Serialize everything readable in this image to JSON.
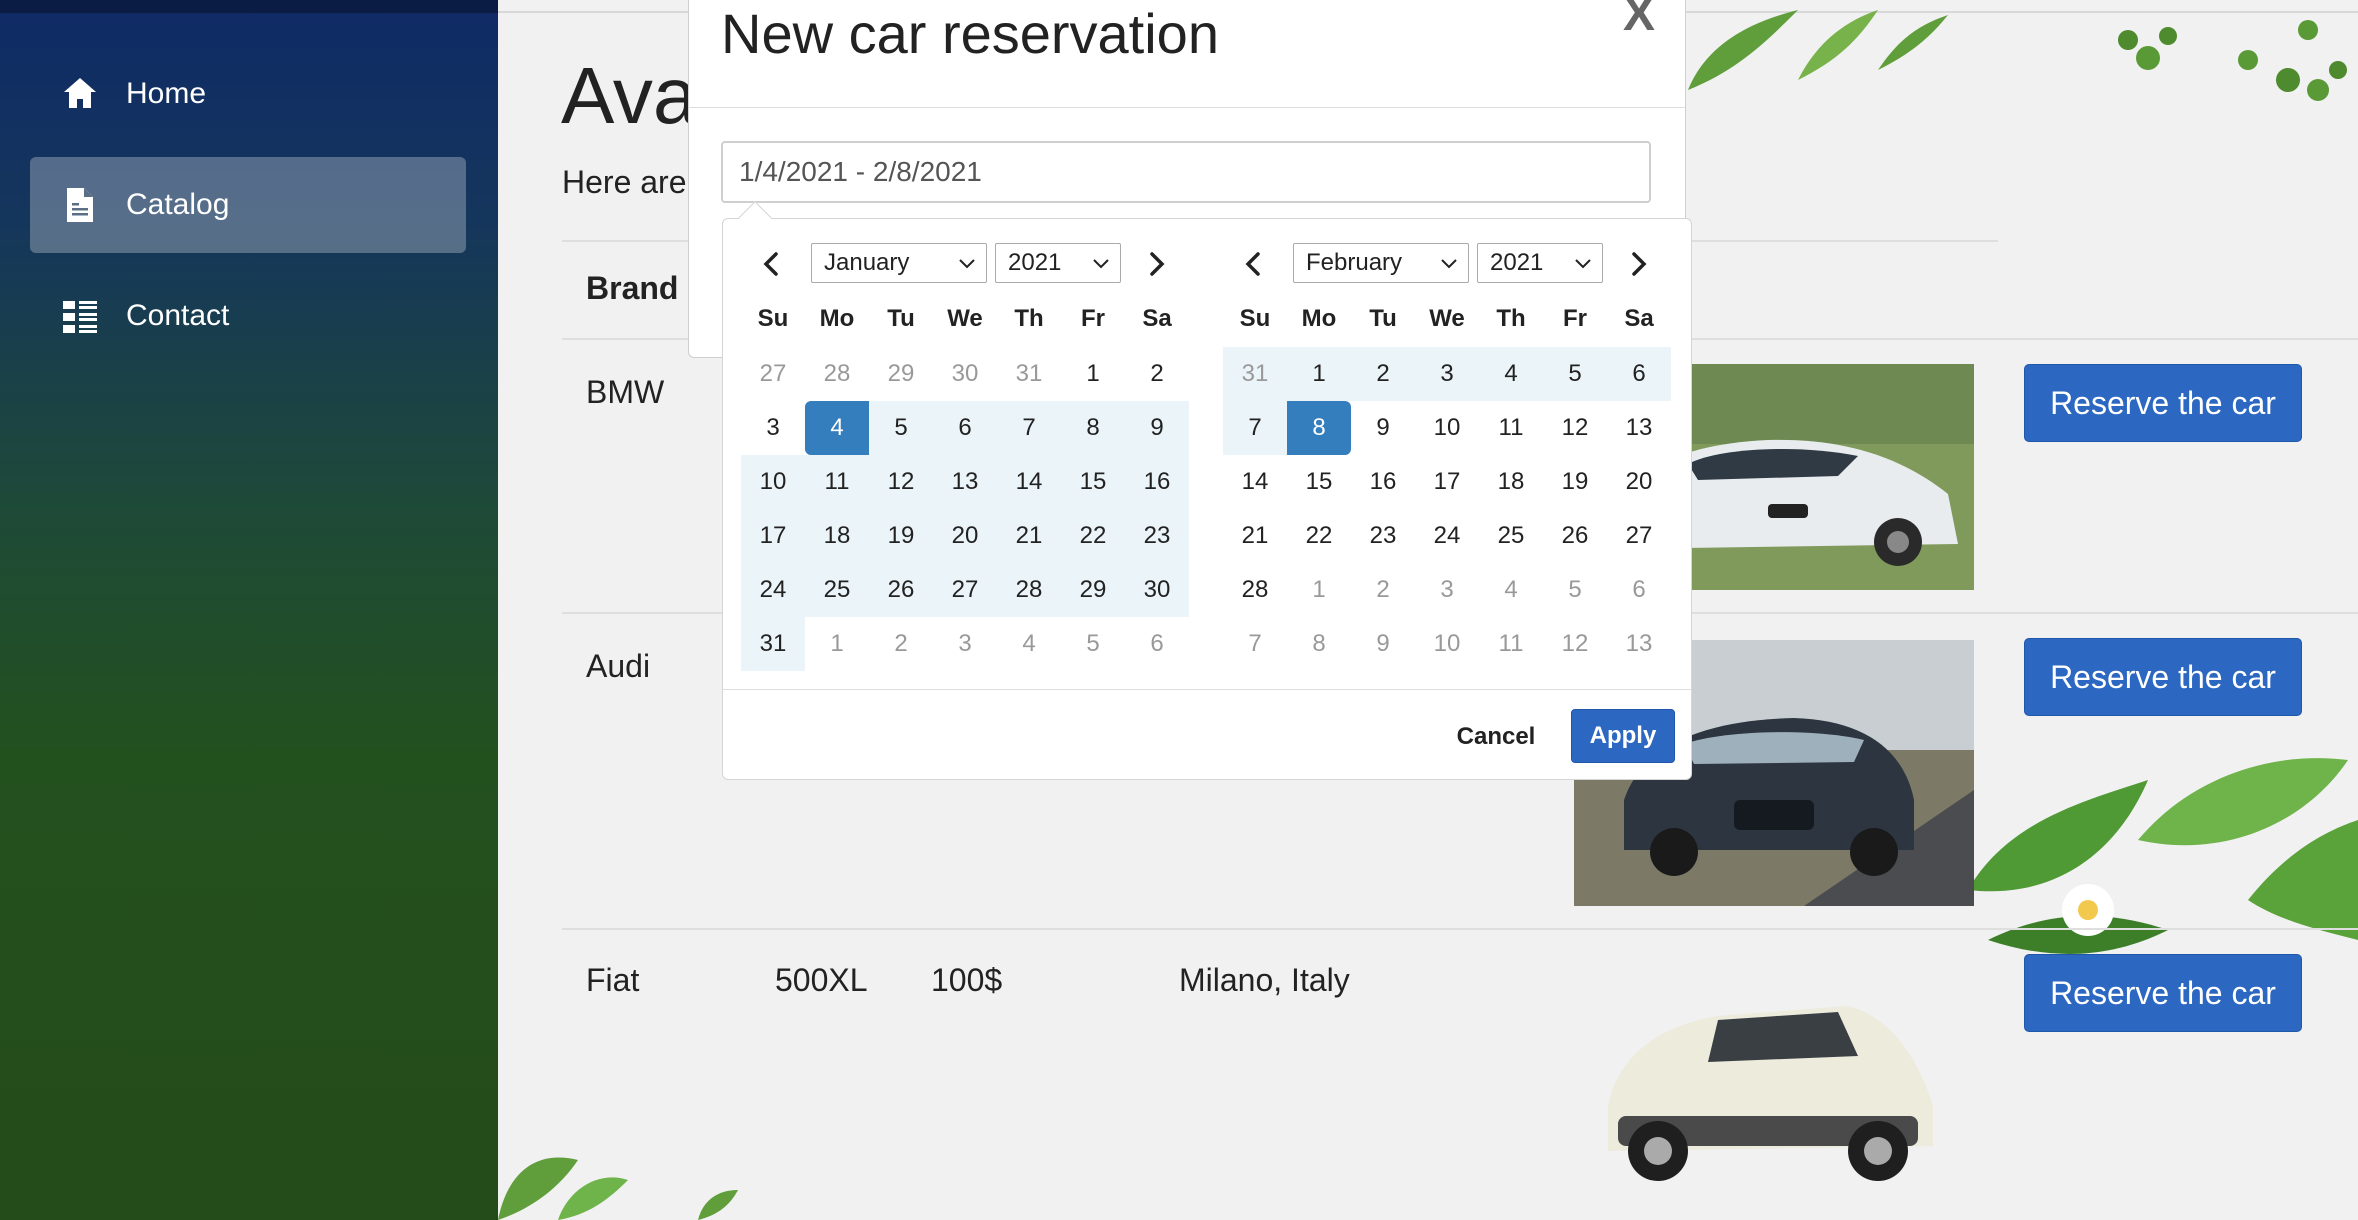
{
  "sidebar": {
    "items": [
      {
        "label": "Home",
        "icon": "home-icon"
      },
      {
        "label": "Catalog",
        "icon": "document-icon"
      },
      {
        "label": "Contact",
        "icon": "list-icon"
      }
    ],
    "active_index": 1
  },
  "main": {
    "title": "Ava",
    "subtitle": "Here are",
    "table": {
      "header_brand": "Brand",
      "rows": [
        {
          "brand": "BMW",
          "model": "",
          "price": "",
          "location": "",
          "button": "Reserve the car"
        },
        {
          "brand": "Audi",
          "model": "",
          "price": "",
          "location": "",
          "button": "Reserve the car"
        },
        {
          "brand": "Fiat",
          "model": "500XL",
          "price": "100$",
          "location": "Milano, Italy",
          "button": "Reserve the car"
        }
      ]
    }
  },
  "modal": {
    "title": "New car reservation",
    "close_label": "X",
    "date_value": "1/4/2021 - 2/8/2021"
  },
  "datepicker": {
    "weekdays": [
      "Su",
      "Mo",
      "Tu",
      "We",
      "Th",
      "Fr",
      "Sa"
    ],
    "left": {
      "month": "January",
      "year": "2021",
      "weeks": [
        [
          "27",
          "28",
          "29",
          "30",
          "31",
          "1",
          "2"
        ],
        [
          "3",
          "4",
          "5",
          "6",
          "7",
          "8",
          "9"
        ],
        [
          "10",
          "11",
          "12",
          "13",
          "14",
          "15",
          "16"
        ],
        [
          "17",
          "18",
          "19",
          "20",
          "21",
          "22",
          "23"
        ],
        [
          "24",
          "25",
          "26",
          "27",
          "28",
          "29",
          "30"
        ],
        [
          "31",
          "1",
          "2",
          "3",
          "4",
          "5",
          "6"
        ]
      ]
    },
    "right": {
      "month": "February",
      "year": "2021",
      "weeks": [
        [
          "31",
          "1",
          "2",
          "3",
          "4",
          "5",
          "6"
        ],
        [
          "7",
          "8",
          "9",
          "10",
          "11",
          "12",
          "13"
        ],
        [
          "14",
          "15",
          "16",
          "17",
          "18",
          "19",
          "20"
        ],
        [
          "21",
          "22",
          "23",
          "24",
          "25",
          "26",
          "27"
        ],
        [
          "28",
          "1",
          "2",
          "3",
          "4",
          "5",
          "6"
        ],
        [
          "7",
          "8",
          "9",
          "10",
          "11",
          "12",
          "13"
        ]
      ]
    },
    "cancel_label": "Cancel",
    "apply_label": "Apply"
  },
  "colors": {
    "accent": "#2c67c1",
    "selected_day": "#357ebd",
    "range_bg": "#ebf4f8"
  }
}
